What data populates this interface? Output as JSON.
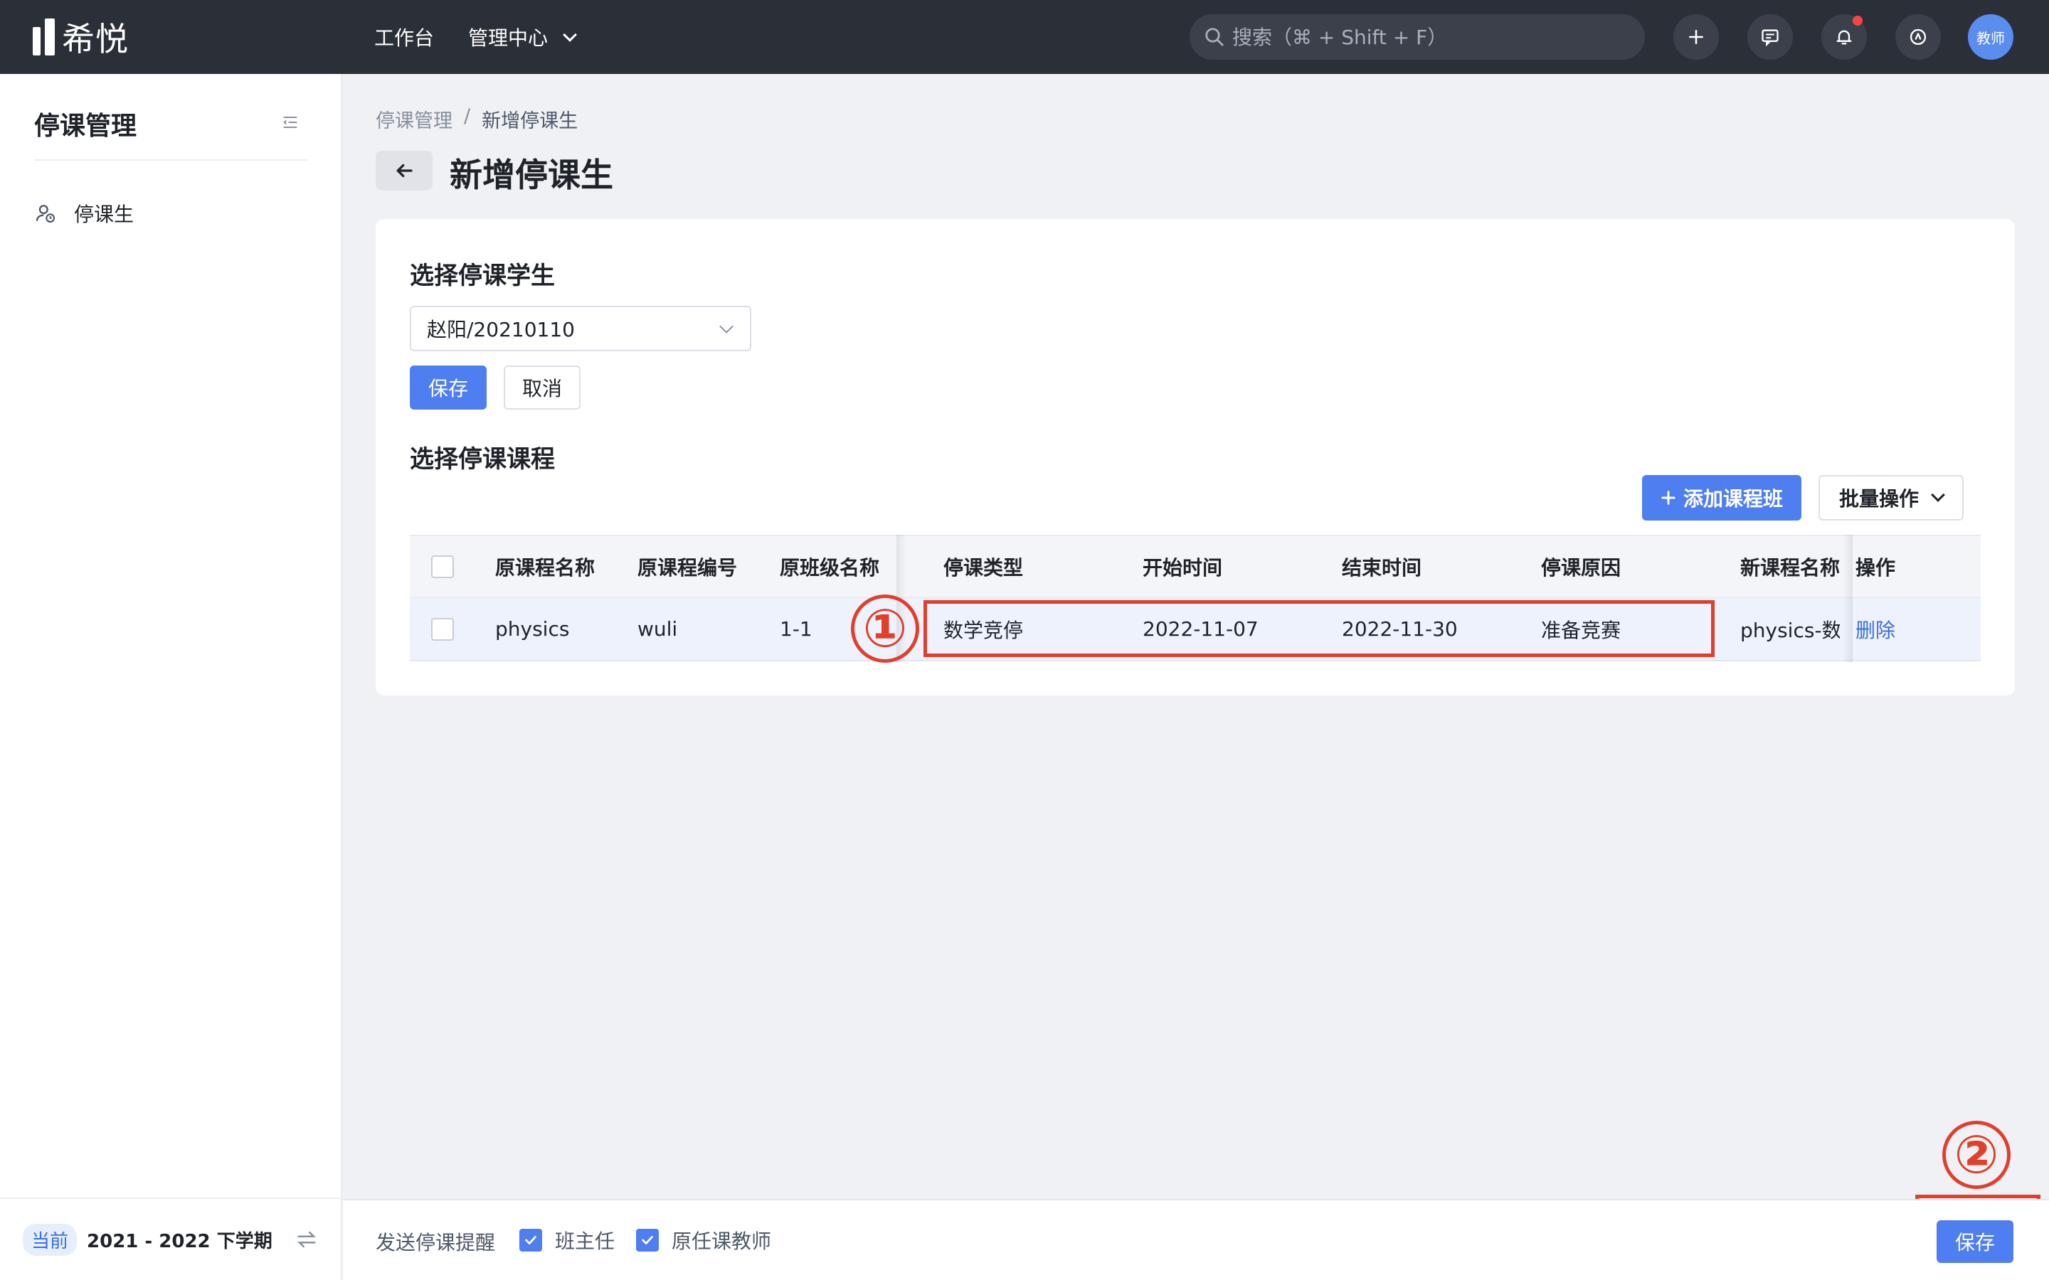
{
  "app": {
    "logo_text": "希悦"
  },
  "topnav": {
    "workbench": "工作台",
    "manage_center": "管理中心",
    "search_placeholder": "搜索（⌘ + Shift + F）",
    "avatar_text": "教师"
  },
  "sidebar": {
    "title": "停课管理",
    "items": [
      {
        "label": "停课生"
      }
    ],
    "footer": {
      "badge": "当前",
      "term": "2021 - 2022 下学期"
    }
  },
  "breadcrumb": [
    "停课管理",
    "/",
    "新增停课生"
  ],
  "page_title": "新增停课生",
  "student_section": {
    "title": "选择停课学生",
    "selected_student": "赵阳/20210110",
    "save_label": "保存",
    "cancel_label": "取消"
  },
  "course_section": {
    "title": "选择停课课程",
    "add_class_label": "添加课程班",
    "batch_label": "批量操作",
    "columns": [
      "原课程名称",
      "原课程编号",
      "原班级名称",
      "停课类型",
      "开始时间",
      "结束时间",
      "停课原因",
      "新课程名称",
      "操作"
    ],
    "rows": [
      {
        "course_name": "physics",
        "course_code": "wuli",
        "class_name": "1-1",
        "suspend_type": "数学竞停",
        "start_date": "2022-11-07",
        "end_date": "2022-11-30",
        "reason": "准备竞赛",
        "new_course_name": "physics-数学",
        "action": "删除"
      }
    ]
  },
  "annotations": {
    "one": "①",
    "two": "②"
  },
  "footer": {
    "label": "发送停课提醒",
    "option_head_teacher": "班主任",
    "option_original_teacher": "原任课教师",
    "save_label": "保存"
  },
  "colors": {
    "primary": "#4f7ef0",
    "annotation": "#e0402b",
    "topbar": "#2b2f38"
  }
}
